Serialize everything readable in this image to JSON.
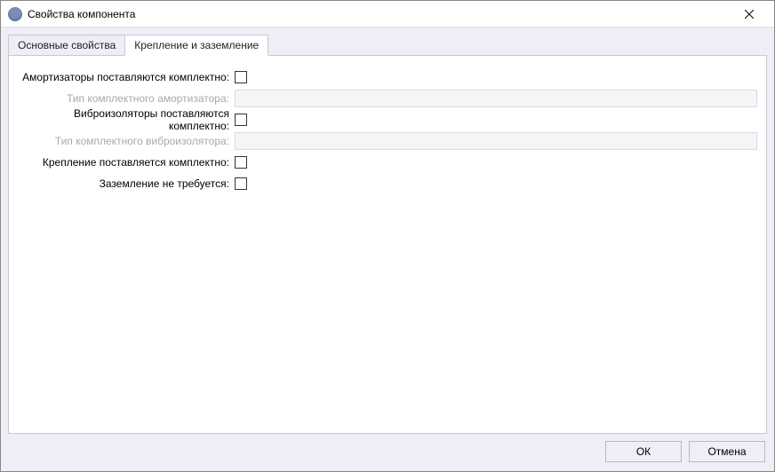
{
  "window": {
    "title": "Свойства компонента"
  },
  "tabs": [
    {
      "label": "Основные свойства",
      "active": false
    },
    {
      "label": "Крепление и заземление",
      "active": true
    }
  ],
  "form": {
    "row1": {
      "label": "Амортизаторы поставляются комплектно:",
      "checked": false,
      "enabled": true
    },
    "row2": {
      "label": "Тип комплектного амортизатора:",
      "value": "",
      "enabled": false
    },
    "row3": {
      "label": "Виброизоляторы поставляются комплектно:",
      "checked": false,
      "enabled": true
    },
    "row4": {
      "label": "Тип комплектного виброизолятора:",
      "value": "",
      "enabled": false
    },
    "row5": {
      "label": "Крепление поставляется комплектно:",
      "checked": false,
      "enabled": true
    },
    "row6": {
      "label": "Заземление не требуется:",
      "checked": false,
      "enabled": true
    }
  },
  "buttons": {
    "ok": "ОК",
    "cancel": "Отмена"
  }
}
